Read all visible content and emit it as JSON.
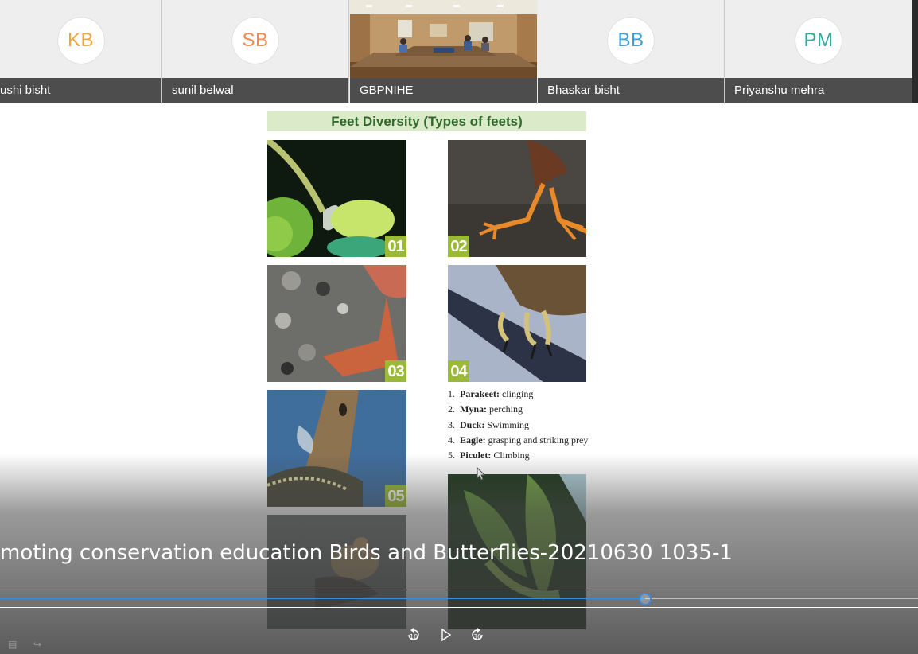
{
  "participants": [
    {
      "initials": "KB",
      "name": "ushi bisht",
      "color": "#f0a73a"
    },
    {
      "initials": "SB",
      "name": "sunil belwal",
      "color": "#f08a52"
    },
    {
      "initials": "",
      "name": "GBPNIHE",
      "color": ""
    },
    {
      "initials": "BB",
      "name": "Bhaskar bisht",
      "color": "#3f9fd0"
    },
    {
      "initials": "PM",
      "name": "Priyanshu mehra",
      "color": "#34a79a"
    }
  ],
  "slide": {
    "title": "Feet Diversity (Types of feets)",
    "photos": [
      {
        "number": "01",
        "subject": "parakeet clinging foot"
      },
      {
        "number": "02",
        "subject": "myna perching feet"
      },
      {
        "number": "03",
        "subject": "duck webbed foot"
      },
      {
        "number": "04",
        "subject": "eagle talons"
      },
      {
        "number": "05",
        "subject": "piculet climbing foot"
      },
      {
        "number": "",
        "subject": "bird on ground"
      },
      {
        "number": "",
        "subject": "green bird in foliage"
      }
    ],
    "legend": [
      {
        "index": "1.",
        "bird": "Parakeet:",
        "type": "clinging"
      },
      {
        "index": "2.",
        "bird": "Myna:",
        "type": "perching"
      },
      {
        "index": "3.",
        "bird": "Duck:",
        "type": "Swimming"
      },
      {
        "index": "4.",
        "bird": "Eagle:",
        "type": "grasping and striking prey"
      },
      {
        "index": "5.",
        "bird": "Piculet:",
        "type": "Climbing"
      }
    ]
  },
  "player": {
    "title": "moting conservation education  Birds and Butterflies-20210630 1035-1",
    "progress": 0.703,
    "rewind_label": "10",
    "forward_label": "30",
    "accent_color": "#3a8be0",
    "icons": [
      "rewind-10-icon",
      "play-icon",
      "forward-30-icon"
    ]
  }
}
